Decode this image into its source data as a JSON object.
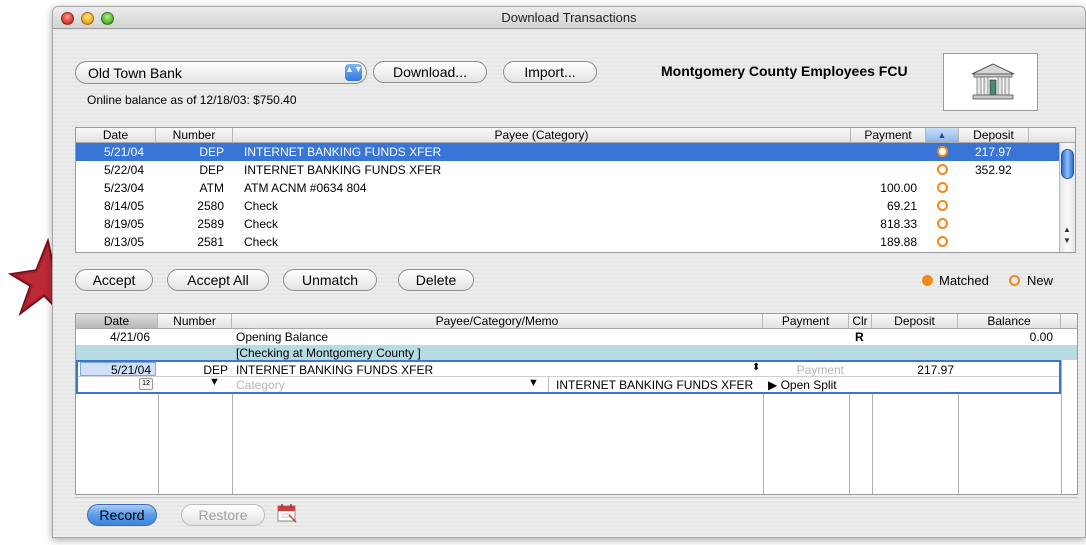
{
  "window": {
    "title": "Download Transactions"
  },
  "account_popup": {
    "value": "Old Town Bank",
    "arrows": "▲▼"
  },
  "buttons": {
    "download": "Download...",
    "import": "Import...",
    "accept": "Accept",
    "accept_all": "Accept All",
    "unmatch": "Unmatch",
    "delete": "Delete",
    "record": "Record",
    "restore": "Restore"
  },
  "institution": {
    "name": "Montgomery County Employees FCU"
  },
  "online_balance": "Online balance as of 12/18/03: $750.40",
  "download_table": {
    "headers": {
      "date": "Date",
      "number": "Number",
      "payee": "Payee (Category)",
      "payment": "Payment",
      "status_sort": "▲",
      "deposit": "Deposit"
    },
    "rows": [
      {
        "date": "5/21/04",
        "number": "DEP",
        "payee": "INTERNET BANKING FUNDS XFER",
        "payment": "",
        "deposit": "217.97"
      },
      {
        "date": "5/22/04",
        "number": "DEP",
        "payee": "INTERNET BANKING FUNDS XFER",
        "payment": "",
        "deposit": "352.92"
      },
      {
        "date": "5/23/04",
        "number": "ATM",
        "payee": "ATM ACNM #0634 804",
        "payment": "100.00",
        "deposit": ""
      },
      {
        "date": "8/14/05",
        "number": "2580",
        "payee": "Check",
        "payment": "69.21",
        "deposit": ""
      },
      {
        "date": "8/19/05",
        "number": "2589",
        "payee": "Check",
        "payment": "818.33",
        "deposit": ""
      },
      {
        "date": "8/13/05",
        "number": "2581",
        "payee": "Check",
        "payment": "189.88",
        "deposit": ""
      }
    ]
  },
  "legend": {
    "matched": "Matched",
    "new": "New",
    "matched_color": "#f08a1e",
    "new_color": "#f08a1e"
  },
  "register": {
    "headers": {
      "date": "Date",
      "number": "Number",
      "payee": "Payee/Category/Memo",
      "payment": "Payment",
      "clr": "Clr",
      "deposit": "Deposit",
      "balance": "Balance"
    },
    "opening": {
      "date": "4/21/06",
      "payee": "Opening Balance",
      "clr": "R",
      "balance": "0.00"
    },
    "account_line": "[Checking at Montgomery County ]",
    "edit": {
      "date": "5/21/04",
      "number": "DEP",
      "payee": "INTERNET BANKING FUNDS XFER",
      "payment_placeholder": "Payment",
      "deposit": "217.97",
      "category_placeholder": "Category",
      "memo": "INTERNET BANKING FUNDS XFER",
      "split": "▶ Open Split",
      "calendar_label": "12"
    }
  },
  "colors": {
    "selection": "#3875d7",
    "accent_star": "#b5202a",
    "register_highlight": "#b6dbe2"
  }
}
